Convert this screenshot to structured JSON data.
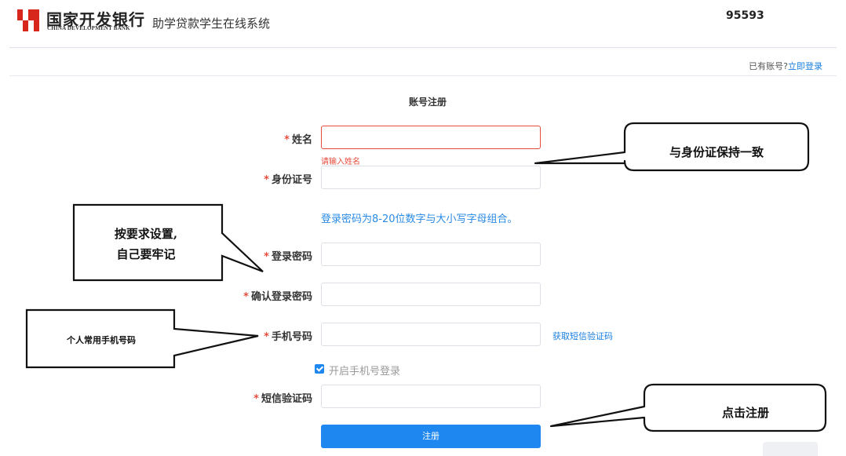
{
  "header": {
    "bank_name_cn": "国家开发银行",
    "bank_name_en": "CHINA DEVELOPMENT BANK",
    "system_title": "助学贷款学生在线系统",
    "hotline": "95593"
  },
  "login_tip": {
    "prefix": "已有账号?",
    "link_label": "立即登录"
  },
  "form": {
    "title": "账号注册",
    "required_mark": "*",
    "fields": {
      "name": {
        "label": "姓名",
        "value": "",
        "error": "请输入姓名"
      },
      "id_number": {
        "label": "身份证号",
        "value": ""
      },
      "password_hint": "登录密码为8-20位数字与大小写字母组合。",
      "password": {
        "label": "登录密码",
        "value": ""
      },
      "confirm_password": {
        "label": "确认登录密码",
        "value": ""
      },
      "phone": {
        "label": "手机号码",
        "value": "",
        "action_label": "获取短信验证码"
      },
      "phone_login": {
        "label": "开启手机号登录",
        "checked": true
      },
      "sms_code": {
        "label": "短信验证码",
        "value": ""
      }
    },
    "submit_label": "注册"
  },
  "annotations": {
    "id_note": "与身份证保持一致",
    "password_note_line1": "按要求设置,",
    "password_note_line2": "自己要牢记",
    "phone_note": "个人常用手机号码",
    "submit_note": "点击注册"
  },
  "colors": {
    "brand_red": "#d7261c",
    "primary_blue": "#1e87f0",
    "error_red": "#e74c3c",
    "link_blue": "#1a7fe0"
  }
}
